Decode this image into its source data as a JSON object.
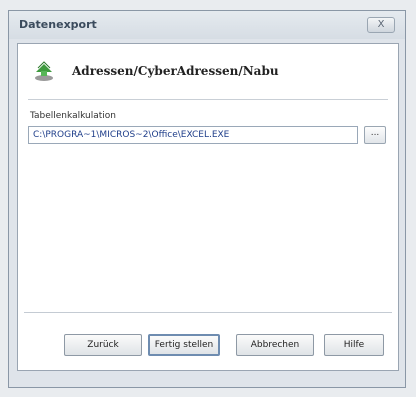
{
  "window": {
    "title": "Datenexport",
    "close_label": "X"
  },
  "header": {
    "path_title": "Adressen/CyberAdressen/Nabu",
    "icon": "export-arrow-icon"
  },
  "form": {
    "field_label": "Tabellenkalkulation",
    "path_value": "C:\\PROGRA~1\\MICROS~2\\Office\\EXCEL.EXE",
    "browse_label": "..."
  },
  "buttons": {
    "back": "Zurück",
    "finish": "Fertig stellen",
    "cancel": "Abbrechen",
    "help": "Hilfe"
  }
}
